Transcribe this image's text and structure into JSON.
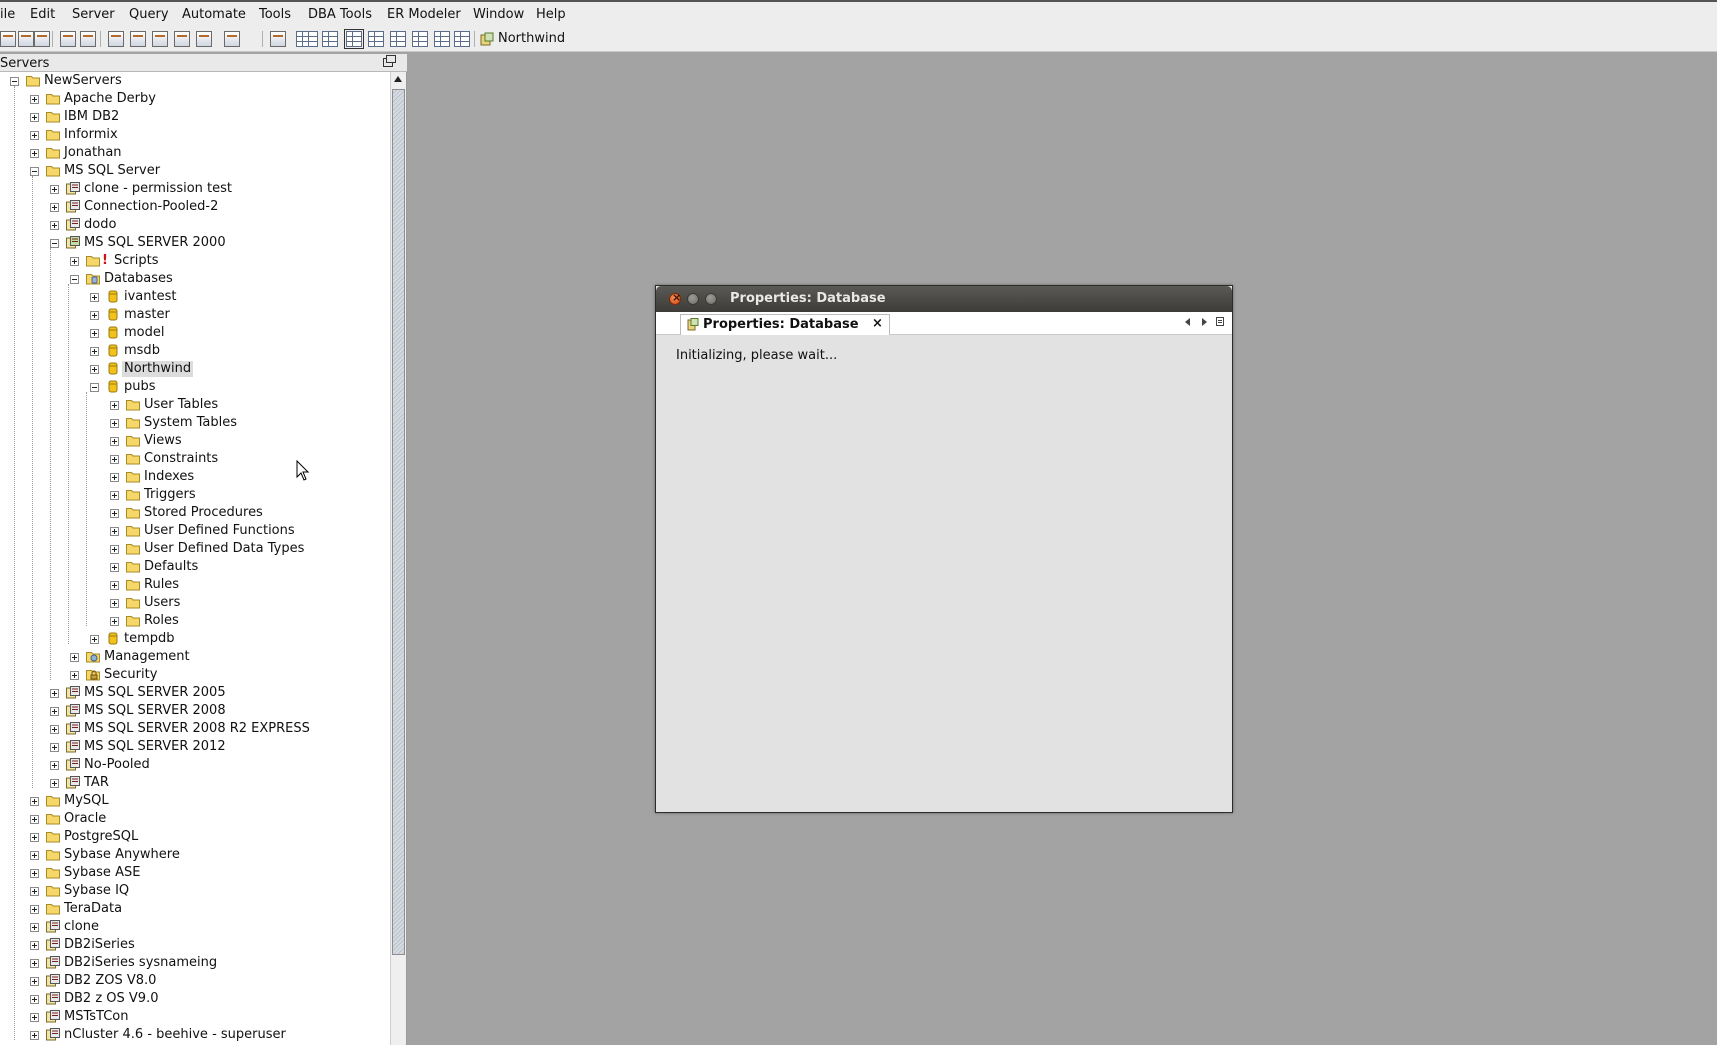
{
  "menubar": {
    "items": [
      {
        "label": "ile"
      },
      {
        "label": "Edit"
      },
      {
        "label": "Server"
      },
      {
        "label": "Query"
      },
      {
        "label": "Automate"
      },
      {
        "label": "Tools"
      },
      {
        "label": "DBA Tools"
      },
      {
        "label": "ER Modeler"
      },
      {
        "label": "Window"
      },
      {
        "label": "Help"
      }
    ]
  },
  "toolbar": {
    "connection_label": "Northwind",
    "icons": [
      "new-connection-icon",
      "disconnect-icon",
      "connect-icon",
      "refresh-icon",
      "query-icon",
      "script-icon",
      "table-icon",
      "view-icon",
      "procedure-icon",
      "export-icon",
      "dropdown-icon",
      "properties-icon",
      "grid-icon"
    ]
  },
  "servers_panel": {
    "title": "Servers",
    "tree": [
      {
        "label": "NewServers",
        "icon": "folder-icon",
        "expanded": true
      },
      {
        "label": "Apache Derby",
        "icon": "folder-icon"
      },
      {
        "label": "IBM DB2",
        "icon": "folder-icon"
      },
      {
        "label": "Informix",
        "icon": "folder-icon"
      },
      {
        "label": "Jonathan",
        "icon": "folder-icon"
      },
      {
        "label": "MS SQL Server",
        "icon": "folder-icon",
        "expanded": true
      },
      {
        "label": "clone - permission test",
        "icon": "server-icon"
      },
      {
        "label": "Connection-Pooled-2",
        "icon": "server-icon"
      },
      {
        "label": "dodo",
        "icon": "server-icon"
      },
      {
        "label": "MS SQL SERVER 2000",
        "icon": "server-connected-icon",
        "expanded": true
      },
      {
        "label": "Scripts",
        "icon": "folder-icon",
        "badge": "!"
      },
      {
        "label": "Databases",
        "icon": "databases-icon",
        "expanded": true
      },
      {
        "label": "ivantest",
        "icon": "database-icon"
      },
      {
        "label": "master",
        "icon": "database-icon"
      },
      {
        "label": "model",
        "icon": "database-icon"
      },
      {
        "label": "msdb",
        "icon": "database-icon"
      },
      {
        "label": "Northwind",
        "icon": "database-icon",
        "selected": true
      },
      {
        "label": "pubs",
        "icon": "database-icon",
        "expanded": true
      },
      {
        "label": "User Tables",
        "icon": "folder-icon"
      },
      {
        "label": "System Tables",
        "icon": "folder-icon"
      },
      {
        "label": "Views",
        "icon": "folder-icon"
      },
      {
        "label": "Constraints",
        "icon": "folder-icon"
      },
      {
        "label": "Indexes",
        "icon": "folder-icon"
      },
      {
        "label": "Triggers",
        "icon": "folder-icon"
      },
      {
        "label": "Stored Procedures",
        "icon": "folder-icon"
      },
      {
        "label": "User Defined Functions",
        "icon": "folder-icon"
      },
      {
        "label": "User Defined Data Types",
        "icon": "folder-icon"
      },
      {
        "label": "Defaults",
        "icon": "folder-icon"
      },
      {
        "label": "Rules",
        "icon": "folder-icon"
      },
      {
        "label": "Users",
        "icon": "folder-icon"
      },
      {
        "label": "Roles",
        "icon": "folder-icon"
      },
      {
        "label": "tempdb",
        "icon": "database-icon"
      },
      {
        "label": "Management",
        "icon": "management-icon"
      },
      {
        "label": "Security",
        "icon": "security-icon"
      },
      {
        "label": "MS SQL SERVER 2005",
        "icon": "server-icon"
      },
      {
        "label": "MS SQL SERVER 2008",
        "icon": "server-icon"
      },
      {
        "label": "MS SQL SERVER 2008 R2 EXPRESS",
        "icon": "server-icon"
      },
      {
        "label": "MS SQL SERVER 2012",
        "icon": "server-icon"
      },
      {
        "label": "No-Pooled",
        "icon": "server-icon"
      },
      {
        "label": "TAR",
        "icon": "server-icon"
      },
      {
        "label": "MySQL",
        "icon": "folder-icon"
      },
      {
        "label": "Oracle",
        "icon": "folder-icon"
      },
      {
        "label": "PostgreSQL",
        "icon": "folder-icon"
      },
      {
        "label": "Sybase Anywhere",
        "icon": "folder-icon"
      },
      {
        "label": "Sybase ASE",
        "icon": "folder-icon"
      },
      {
        "label": "Sybase IQ",
        "icon": "folder-icon"
      },
      {
        "label": "TeraData",
        "icon": "folder-icon"
      },
      {
        "label": "clone",
        "icon": "server-icon"
      },
      {
        "label": "DB2iSeries",
        "icon": "server-icon"
      },
      {
        "label": "DB2iSeries sysnameing",
        "icon": "server-icon"
      },
      {
        "label": "DB2 ZOS V8.0",
        "icon": "server-icon"
      },
      {
        "label": "DB2 z OS V9.0",
        "icon": "server-icon"
      },
      {
        "label": "MSTsTCon",
        "icon": "server-icon"
      },
      {
        "label": "nCluster 4.6 - beehive - superuser",
        "icon": "server-icon"
      }
    ]
  },
  "dialog": {
    "title": "Properties: Database",
    "tab_label": "Properties: Database",
    "tab_close": "×",
    "status": "Initializing, please wait..."
  },
  "colors": {
    "folder": "#f5d35a",
    "database": "#f0c020",
    "desktop": "#a3a3a3",
    "titlebar": "#3d3c38"
  }
}
